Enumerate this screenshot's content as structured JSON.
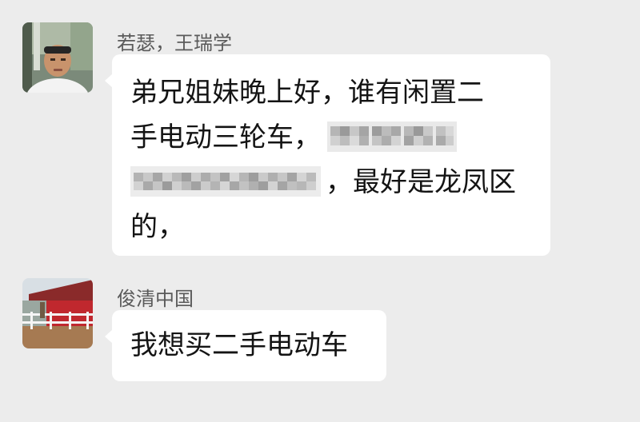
{
  "messages": [
    {
      "sender": "若瑟，王瑞学",
      "lines": [
        "弟兄姐妹晚上好，谁有闲置二",
        "手电动三轮车，",
        "，最好是龙凤区",
        "的，"
      ],
      "redacted_items": [
        "redacted-name",
        "redacted-phone-number"
      ]
    },
    {
      "sender": "俊清中国",
      "lines": [
        "我想买二手电动车"
      ]
    }
  ]
}
